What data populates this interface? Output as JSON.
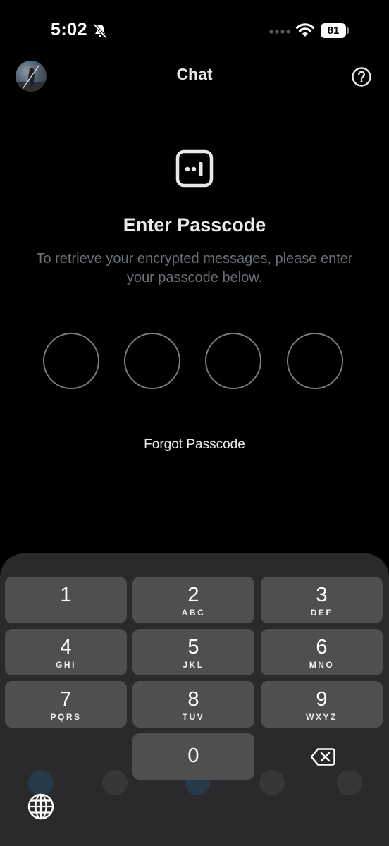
{
  "status_bar": {
    "time": "5:02",
    "battery": "81",
    "icons": [
      "bell-off-icon",
      "cellular-dots-icon",
      "wifi-icon",
      "battery-icon"
    ]
  },
  "header": {
    "title": "Chat",
    "avatar_icon": "avatar",
    "help_icon": "help-icon"
  },
  "main": {
    "lock_icon": "encrypted-lock-icon",
    "title": "Enter Passcode",
    "description": "To retrieve your encrypted messages, please enter your passcode below.",
    "pin_length": 4,
    "forgot_label": "Forgot Passcode"
  },
  "keypad": {
    "keys": [
      {
        "digit": "1",
        "letters": ""
      },
      {
        "digit": "2",
        "letters": "ABC"
      },
      {
        "digit": "3",
        "letters": "DEF"
      },
      {
        "digit": "4",
        "letters": "GHI"
      },
      {
        "digit": "5",
        "letters": "JKL"
      },
      {
        "digit": "6",
        "letters": "MNO"
      },
      {
        "digit": "7",
        "letters": "PQRS"
      },
      {
        "digit": "8",
        "letters": "TUV"
      },
      {
        "digit": "9",
        "letters": "WXYZ"
      },
      {
        "digit": "0",
        "letters": ""
      }
    ],
    "backspace_icon": "backspace-icon",
    "globe_icon": "globe-icon"
  },
  "colors": {
    "background": "#000000",
    "text_primary": "#e7e9ea",
    "text_secondary": "#6b7076",
    "pin_border": "#7a7d82",
    "keypad_bg": "#2a2a2c",
    "key_bg": "#4f4f52"
  }
}
